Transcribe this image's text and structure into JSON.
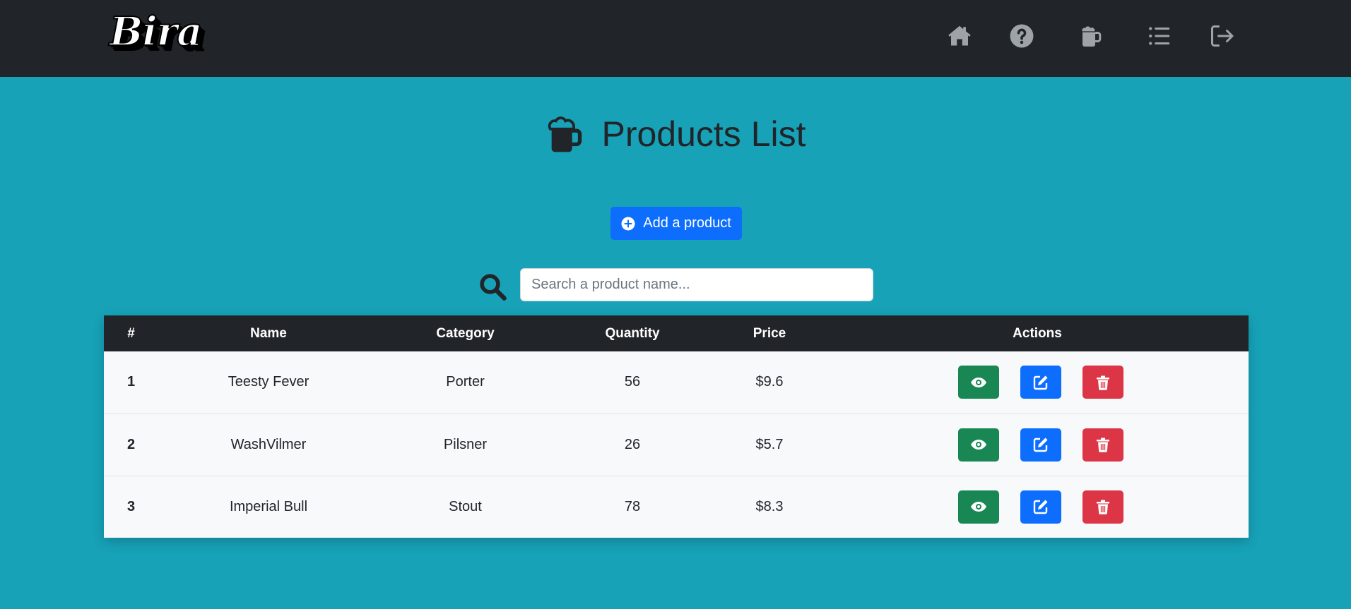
{
  "navbar": {
    "logo_text": "Bira",
    "icons": [
      "home-icon",
      "question-circle-icon",
      "beer-mug-icon",
      "list-icon",
      "logout-icon"
    ],
    "icon_color": "#9ea3a8",
    "background": "#212529"
  },
  "page": {
    "title": "Products List",
    "title_icon": "beer-mug-icon",
    "background": "#17a2b8"
  },
  "add_button": {
    "label": "Add a product",
    "icon": "plus-circle-icon",
    "color": "#0d6efd"
  },
  "search": {
    "icon": "search-icon",
    "placeholder": "Search a product name...",
    "value": ""
  },
  "table": {
    "columns": [
      "#",
      "Name",
      "Category",
      "Quantity",
      "Price",
      "Actions"
    ],
    "rows": [
      {
        "idx": "1",
        "name": "Teesty Fever",
        "category": "Porter",
        "quantity": "56",
        "price": "$9.6"
      },
      {
        "idx": "2",
        "name": "WashVilmer",
        "category": "Pilsner",
        "quantity": "26",
        "price": "$5.7"
      },
      {
        "idx": "3",
        "name": "Imperial Bull",
        "category": "Stout",
        "quantity": "78",
        "price": "$8.3"
      }
    ],
    "action_icons": {
      "view": "eye-icon",
      "edit": "edit-icon",
      "delete": "trash-icon"
    },
    "action_colors": {
      "view": "#198754",
      "edit": "#0d6efd",
      "delete": "#dc3545"
    }
  }
}
